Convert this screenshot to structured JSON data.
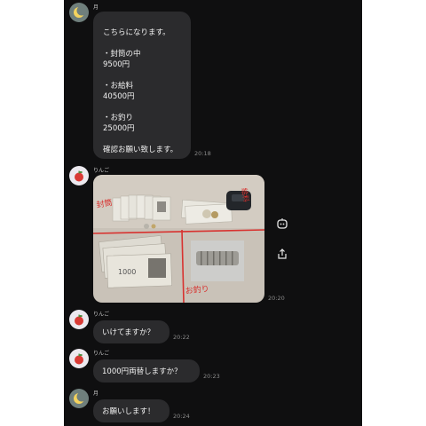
{
  "messages": [
    {
      "sender": "月",
      "text": "こちらになります。\n\n・封筒の中\n9500円\n\n・お給料\n40500円\n\n・お釣り\n25000円\n\n確認お願い致します。",
      "time": "20:18"
    },
    {
      "sender": "りんご",
      "photo_annotations": [
        "封筒",
        "給料",
        "お釣り"
      ],
      "photo_note": "1000",
      "time": "20:20"
    },
    {
      "sender": "りんご",
      "text": "いけてますか？",
      "time": "20:22"
    },
    {
      "sender": "りんご",
      "text": "1000円両替しますか？",
      "time": "20:23"
    },
    {
      "sender": "月",
      "text": "お願いします！",
      "time": "20:24"
    }
  ],
  "colors": {
    "chat_bg": "#0f0f10",
    "bubble": "#2b2b2d",
    "accent_red": "#d8322f"
  },
  "icons": [
    "moon-avatar-icon",
    "apple-avatar-icon",
    "bot-icon",
    "share-icon"
  ]
}
